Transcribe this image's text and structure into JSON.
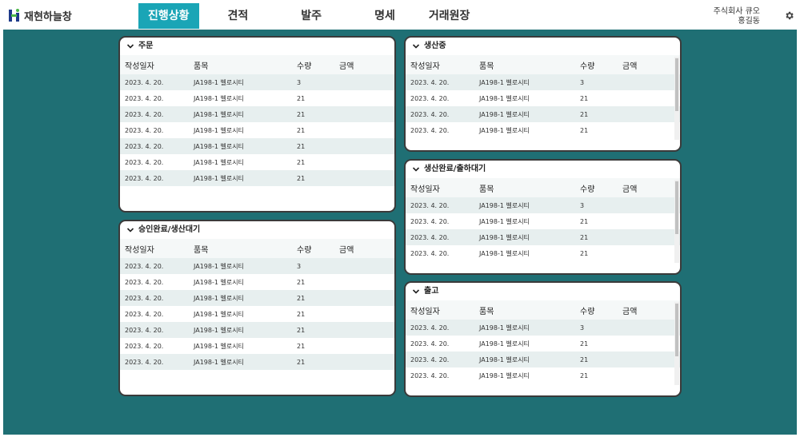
{
  "app": {
    "logo_text": "재현하늘창"
  },
  "nav": {
    "items": [
      {
        "label": "진행상황",
        "active": true
      },
      {
        "label": "견적",
        "active": false
      },
      {
        "label": "발주",
        "active": false
      },
      {
        "label": "명세",
        "active": false
      },
      {
        "label": "거래원장",
        "active": false
      }
    ]
  },
  "user": {
    "company": "주식회사 큐오",
    "name": "홍길동"
  },
  "columns": [
    "작성일자",
    "품목",
    "수량",
    "금액"
  ],
  "panels": [
    {
      "title": "주문",
      "rows": [
        [
          "2023. 4. 20.",
          "JA198-1 벨로시티",
          "3",
          ""
        ],
        [
          "2023. 4. 20.",
          "JA198-1 벨로시티",
          "21",
          ""
        ],
        [
          "2023. 4. 20.",
          "JA198-1 벨로시티",
          "21",
          ""
        ],
        [
          "2023. 4. 20.",
          "JA198-1 벨로시티",
          "21",
          ""
        ],
        [
          "2023. 4. 20.",
          "JA198-1 벨로시티",
          "21",
          ""
        ],
        [
          "2023. 4. 20.",
          "JA198-1 벨로시티",
          "21",
          ""
        ],
        [
          "2023. 4. 20.",
          "JA198-1 벨로시티",
          "21",
          ""
        ]
      ]
    },
    {
      "title": "승인완료/생산대기",
      "rows": [
        [
          "2023. 4. 20.",
          "JA198-1 벨로시티",
          "3",
          ""
        ],
        [
          "2023. 4. 20.",
          "JA198-1 벨로시티",
          "21",
          ""
        ],
        [
          "2023. 4. 20.",
          "JA198-1 벨로시티",
          "21",
          ""
        ],
        [
          "2023. 4. 20.",
          "JA198-1 벨로시티",
          "21",
          ""
        ],
        [
          "2023. 4. 20.",
          "JA198-1 벨로시티",
          "21",
          ""
        ],
        [
          "2023. 4. 20.",
          "JA198-1 벨로시티",
          "21",
          ""
        ],
        [
          "2023. 4. 20.",
          "JA198-1 벨로시티",
          "21",
          ""
        ]
      ]
    },
    {
      "title": "생산중",
      "rows": [
        [
          "2023. 4. 20.",
          "JA198-1 벨로시티",
          "3",
          ""
        ],
        [
          "2023. 4. 20.",
          "JA198-1 벨로시티",
          "21",
          ""
        ],
        [
          "2023. 4. 20.",
          "JA198-1 벨로시티",
          "21",
          ""
        ],
        [
          "2023. 4. 20.",
          "JA198-1 벨로시티",
          "21",
          ""
        ]
      ]
    },
    {
      "title": "생산완료/출하대기",
      "rows": [
        [
          "2023. 4. 20.",
          "JA198-1 벨로시티",
          "3",
          ""
        ],
        [
          "2023. 4. 20.",
          "JA198-1 벨로시티",
          "21",
          ""
        ],
        [
          "2023. 4. 20.",
          "JA198-1 벨로시티",
          "21",
          ""
        ],
        [
          "2023. 4. 20.",
          "JA198-1 벨로시티",
          "21",
          ""
        ]
      ]
    },
    {
      "title": "출고",
      "rows": [
        [
          "2023. 4. 20.",
          "JA198-1 벨로시티",
          "3",
          ""
        ],
        [
          "2023. 4. 20.",
          "JA198-1 벨로시티",
          "21",
          ""
        ],
        [
          "2023. 4. 20.",
          "JA198-1 벨로시티",
          "21",
          ""
        ],
        [
          "2023. 4. 20.",
          "JA198-1 벨로시티",
          "21",
          ""
        ]
      ]
    }
  ],
  "colors": {
    "accent": "#1aa5b6",
    "background": "#1f6f74",
    "row_alt": "#e7efef",
    "logo_blue": "#1e3a8a",
    "logo_green": "#4cb848"
  },
  "icons": {
    "settings": "gear-icon",
    "collapse": "chevron-down-icon",
    "logo": "logo-mark-icon"
  }
}
